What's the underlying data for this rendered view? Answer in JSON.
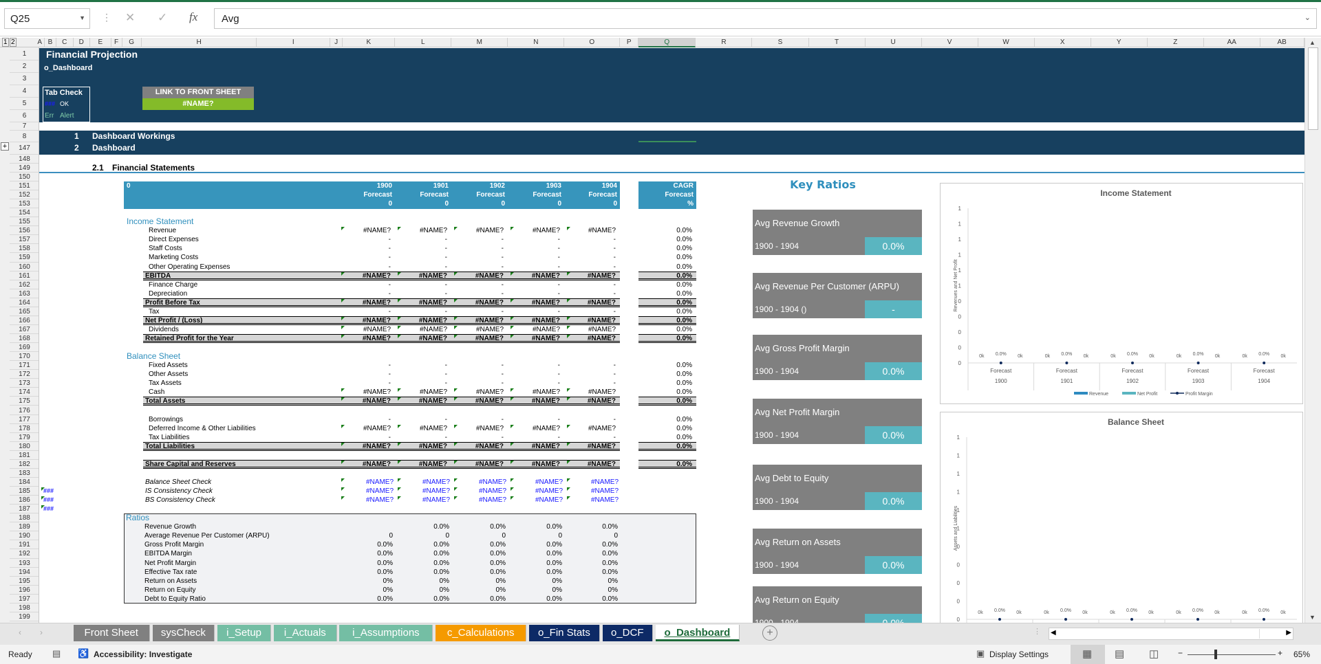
{
  "formula_bar": {
    "name_box": "Q25",
    "formula": "Avg",
    "cancel_icon": "✕",
    "enter_icon": "✓",
    "fx_icon": "fx"
  },
  "outline_levels": [
    "1",
    "2"
  ],
  "columns": [
    "A",
    "B",
    "C",
    "D",
    "E",
    "F",
    "G",
    "H",
    "I",
    "J",
    "K",
    "L",
    "M",
    "N",
    "O",
    "P",
    "Q",
    "R",
    "S",
    "T",
    "U",
    "V",
    "W",
    "X",
    "Y",
    "Z",
    "AA",
    "AB"
  ],
  "selected_column": "Q",
  "rows": [
    1,
    2,
    3,
    4,
    5,
    6,
    7,
    8,
    147,
    148,
    149,
    150,
    151,
    152,
    153,
    154,
    155,
    156,
    157,
    158,
    159,
    160,
    161,
    162,
    163,
    164,
    165,
    166,
    167,
    168,
    169,
    170,
    171,
    172,
    173,
    174,
    175,
    176,
    177,
    178,
    179,
    180,
    181,
    182,
    183,
    184,
    185,
    186,
    187,
    188,
    189,
    190,
    191,
    192,
    193,
    194,
    195,
    196,
    197,
    198,
    199
  ],
  "header": {
    "title": "Financial Projection",
    "sheet": "o_Dashboard",
    "tab_check": {
      "label": "Tab Check",
      "count": "###",
      "status": "OK",
      "err": "Err",
      "alert": "Alert"
    },
    "link_label": "LINK TO FRONT SHEET",
    "link_value": "#NAME?"
  },
  "sections": [
    {
      "num": "1",
      "label": "Dashboard Workings"
    },
    {
      "num": "2",
      "label": "Dashboard"
    }
  ],
  "subsection": {
    "num": "2.1",
    "label": "Financial Statements"
  },
  "outline_markers": [
    "###",
    "###",
    "###"
  ],
  "table_header": {
    "corner": "0",
    "years": [
      "1900",
      "1901",
      "1902",
      "1903",
      "1904"
    ],
    "type": "Forecast",
    "sub": [
      "0",
      "0",
      "0",
      "0",
      "0"
    ],
    "cagr": {
      "label": "CAGR",
      "type": "Forecast",
      "unit": "%"
    }
  },
  "statements": [
    {
      "row": 155,
      "section": "Income Statement"
    },
    {
      "row": 156,
      "label": "Revenue",
      "values": [
        "#NAME?",
        "#NAME?",
        "#NAME?",
        "#NAME?",
        "#NAME?"
      ],
      "cagr": "0.0%"
    },
    {
      "row": 157,
      "label": "Direct Expenses",
      "values": [
        "-",
        "-",
        "-",
        "-",
        "-"
      ],
      "cagr": "0.0%"
    },
    {
      "row": 158,
      "label": "Staff Costs",
      "values": [
        "-",
        "-",
        "-",
        "-",
        "-"
      ],
      "cagr": "0.0%"
    },
    {
      "row": 159,
      "label": "Marketing Costs",
      "values": [
        "-",
        "-",
        "-",
        "-",
        "-"
      ],
      "cagr": "0.0%"
    },
    {
      "row": 160,
      "label": "Other Operating Expenses",
      "values": [
        "-",
        "-",
        "-",
        "-",
        "-"
      ],
      "cagr": "0.0%"
    },
    {
      "row": 161,
      "label": "EBITDA",
      "values": [
        "#NAME?",
        "#NAME?",
        "#NAME?",
        "#NAME?",
        "#NAME?"
      ],
      "cagr": "0.0%",
      "total": true
    },
    {
      "row": 162,
      "label": "Finance Charge",
      "values": [
        "-",
        "-",
        "-",
        "-",
        "-"
      ],
      "cagr": "0.0%"
    },
    {
      "row": 163,
      "label": "Depreciation",
      "values": [
        "-",
        "-",
        "-",
        "-",
        "-"
      ],
      "cagr": "0.0%"
    },
    {
      "row": 164,
      "label": "Profit Before Tax",
      "values": [
        "#NAME?",
        "#NAME?",
        "#NAME?",
        "#NAME?",
        "#NAME?"
      ],
      "cagr": "0.0%",
      "total": true
    },
    {
      "row": 165,
      "label": "Tax",
      "values": [
        "-",
        "-",
        "-",
        "-",
        "-"
      ],
      "cagr": "0.0%"
    },
    {
      "row": 166,
      "label": "Net Profit / (Loss)",
      "values": [
        "#NAME?",
        "#NAME?",
        "#NAME?",
        "#NAME?",
        "#NAME?"
      ],
      "cagr": "0.0%",
      "total": true
    },
    {
      "row": 167,
      "label": "Dividends",
      "values": [
        "#NAME?",
        "#NAME?",
        "#NAME?",
        "#NAME?",
        "#NAME?"
      ],
      "cagr": "0.0%"
    },
    {
      "row": 168,
      "label": "Retained Profit for the Year",
      "values": [
        "#NAME?",
        "#NAME?",
        "#NAME?",
        "#NAME?",
        "#NAME?"
      ],
      "cagr": "0.0%",
      "total": true
    },
    {
      "row": 170,
      "section": "Balance Sheet"
    },
    {
      "row": 171,
      "label": "Fixed Assets",
      "values": [
        "-",
        "-",
        "-",
        "-",
        "-"
      ],
      "cagr": "0.0%"
    },
    {
      "row": 172,
      "label": "Other Assets",
      "values": [
        "-",
        "-",
        "-",
        "-",
        "-"
      ],
      "cagr": "0.0%"
    },
    {
      "row": 173,
      "label": "Tax Assets",
      "values": [
        "-",
        "-",
        "-",
        "-",
        "-"
      ],
      "cagr": "0.0%"
    },
    {
      "row": 174,
      "label": "Cash",
      "values": [
        "#NAME?",
        "#NAME?",
        "#NAME?",
        "#NAME?",
        "#NAME?"
      ],
      "cagr": "0.0%"
    },
    {
      "row": 175,
      "label": "Total Assets",
      "values": [
        "#NAME?",
        "#NAME?",
        "#NAME?",
        "#NAME?",
        "#NAME?"
      ],
      "cagr": "0.0%",
      "total": true
    },
    {
      "row": 177,
      "label": "Borrowings",
      "values": [
        "-",
        "-",
        "-",
        "-",
        "-"
      ],
      "cagr": "0.0%"
    },
    {
      "row": 178,
      "label": "Deferred Income & Other Liabilities",
      "values": [
        "#NAME?",
        "#NAME?",
        "#NAME?",
        "#NAME?",
        "#NAME?"
      ],
      "cagr": "0.0%"
    },
    {
      "row": 179,
      "label": "Tax Liabilities",
      "values": [
        "-",
        "-",
        "-",
        "-",
        "-"
      ],
      "cagr": "0.0%"
    },
    {
      "row": 180,
      "label": "Total Liabilities",
      "values": [
        "#NAME?",
        "#NAME?",
        "#NAME?",
        "#NAME?",
        "#NAME?"
      ],
      "cagr": "0.0%",
      "total": true
    },
    {
      "row": 182,
      "label": "Share Capital and Reserves",
      "values": [
        "#NAME?",
        "#NAME?",
        "#NAME?",
        "#NAME?",
        "#NAME?"
      ],
      "cagr": "0.0%",
      "total": true
    },
    {
      "row": 184,
      "label": "Balance Sheet Check",
      "values": [
        "#NAME?",
        "#NAME?",
        "#NAME?",
        "#NAME?",
        "#NAME?"
      ],
      "check": true
    },
    {
      "row": 185,
      "label": "IS Consistency Check",
      "values": [
        "#NAME?",
        "#NAME?",
        "#NAME?",
        "#NAME?",
        "#NAME?"
      ],
      "check": true
    },
    {
      "row": 186,
      "label": "BS Consistency Check",
      "values": [
        "#NAME?",
        "#NAME?",
        "#NAME?",
        "#NAME?",
        "#NAME?"
      ],
      "check": true
    }
  ],
  "ratios": {
    "title": "Ratios",
    "rows": [
      {
        "label": "Revenue Growth",
        "values": [
          "",
          "0.0%",
          "0.0%",
          "0.0%",
          "0.0%"
        ]
      },
      {
        "label": "Average Revenue Per Customer (ARPU)",
        "values": [
          "0",
          "0",
          "0",
          "0",
          "0"
        ]
      },
      {
        "label": "Gross Profit Margin",
        "values": [
          "0.0%",
          "0.0%",
          "0.0%",
          "0.0%",
          "0.0%"
        ]
      },
      {
        "label": "EBITDA Margin",
        "values": [
          "0.0%",
          "0.0%",
          "0.0%",
          "0.0%",
          "0.0%"
        ]
      },
      {
        "label": "Net Profit Margin",
        "values": [
          "0.0%",
          "0.0%",
          "0.0%",
          "0.0%",
          "0.0%"
        ]
      },
      {
        "label": "Effective Tax rate",
        "values": [
          "0.0%",
          "0.0%",
          "0.0%",
          "0.0%",
          "0.0%"
        ]
      },
      {
        "label": "Return on Assets",
        "values": [
          "0%",
          "0%",
          "0%",
          "0%",
          "0%"
        ]
      },
      {
        "label": "Return on Equity",
        "values": [
          "0%",
          "0%",
          "0%",
          "0%",
          "0%"
        ]
      },
      {
        "label": "Debt to Equity Ratio",
        "values": [
          "0.0%",
          "0.0%",
          "0.0%",
          "0.0%",
          "0.0%"
        ]
      }
    ]
  },
  "key_ratios": {
    "title": "Key Ratios",
    "cards": [
      {
        "title": "Avg Revenue Growth",
        "period": "1900 - 1904",
        "value": "0.0%"
      },
      {
        "title": "Avg Revenue Per Customer (ARPU)",
        "period": "1900 - 1904 ()",
        "value": "-"
      },
      {
        "title": "Avg Gross Profit Margin",
        "period": "1900 - 1904",
        "value": "0.0%"
      },
      {
        "title": "Avg Net Profit Margin",
        "period": "1900 - 1904",
        "value": "0.0%"
      },
      {
        "title": "Avg Debt to Equity",
        "period": "1900 - 1904",
        "value": "0.0%"
      },
      {
        "title": "Avg Return on Assets",
        "period": "1900 - 1904",
        "value": "0.0%"
      },
      {
        "title": "Avg Return on Equity",
        "period": "1900 - 1904",
        "value": "0.0%"
      }
    ]
  },
  "chart_data": [
    {
      "type": "bar",
      "title": "Income Statement",
      "ylabel": "Revenues and Net Profit",
      "y_tick_labels": [
        "1",
        "1",
        "1",
        "1",
        "1",
        "1",
        "0",
        "0",
        "0",
        "0",
        "0"
      ],
      "categories": [
        [
          "Forecast",
          "1900"
        ],
        [
          "Forecast",
          "1901"
        ],
        [
          "Forecast",
          "1902"
        ],
        [
          "Forecast",
          "1903"
        ],
        [
          "Forecast",
          "1904"
        ]
      ],
      "series": [
        {
          "name": "Revenue",
          "kind": "bar",
          "values": [
            0,
            0,
            0,
            0,
            0
          ],
          "labels": [
            "0k",
            "0k",
            "0k",
            "0k",
            "0k"
          ],
          "color": "#2e8bc0"
        },
        {
          "name": "Net Profit",
          "kind": "bar",
          "values": [
            0,
            0,
            0,
            0,
            0
          ],
          "labels": [
            "0k",
            "0k",
            "0k",
            "0k",
            "0k"
          ],
          "color": "#5ab5c0"
        },
        {
          "name": "Profit Margin",
          "kind": "line",
          "values": [
            0,
            0,
            0,
            0,
            0
          ],
          "labels": [
            "0.0%",
            "0.0%",
            "0.0%",
            "0.0%",
            "0.0%"
          ],
          "color": "#0f2a5c"
        }
      ],
      "legend": "bottom",
      "grid": false
    },
    {
      "type": "bar",
      "title": "Balance Sheet",
      "ylabel": "Assets and Liabilities",
      "y_tick_labels": [
        "1",
        "1",
        "1",
        "1",
        "1",
        "1",
        "0",
        "0",
        "0",
        "0",
        "0"
      ],
      "categories": [
        [
          "",
          ""
        ],
        [
          "",
          ""
        ],
        [
          "",
          ""
        ],
        [
          "",
          ""
        ],
        [
          "",
          ""
        ]
      ],
      "series": [
        {
          "kind": "bar",
          "values": [
            0,
            0,
            0,
            0,
            0
          ],
          "labels": [
            "0k",
            "0k",
            "0k",
            "0k",
            "0k"
          ],
          "color": "#2e8bc0"
        },
        {
          "kind": "bar",
          "values": [
            0,
            0,
            0,
            0,
            0
          ],
          "labels": [
            "0k",
            "0k",
            "0k",
            "0k",
            "0k"
          ],
          "color": "#5ab5c0"
        },
        {
          "kind": "line",
          "values": [
            0,
            0,
            0,
            0,
            0
          ],
          "labels": [
            "0.0%",
            "0.0%",
            "0.0%",
            "0.0%",
            "0.0%"
          ],
          "color": "#0f2a5c"
        }
      ],
      "legend": "none",
      "grid": false
    }
  ],
  "sheet_tabs": [
    {
      "label": "Front Sheet",
      "color": "#808080"
    },
    {
      "label": "sysCheck",
      "color": "#808080"
    },
    {
      "label": "i_Setup",
      "color": "#74bea4"
    },
    {
      "label": "i_Actuals",
      "color": "#74bea4"
    },
    {
      "label": "i_Assumptions",
      "color": "#74bea4"
    },
    {
      "label": "c_Calculations",
      "color": "#f59a00"
    },
    {
      "label": "o_Fin Stats",
      "color": "#0d2a66"
    },
    {
      "label": "o_DCF",
      "color": "#0d2a66"
    },
    {
      "label": "o_Dashboard",
      "color": "#ffffff",
      "active": true
    }
  ],
  "status_bar": {
    "ready": "Ready",
    "accessibility": "Accessibility: Investigate",
    "display_settings": "Display Settings",
    "zoom": "65%"
  },
  "colors": {
    "band": "#17405f",
    "table_header": "#3795bc",
    "card": "#808080",
    "card_value": "#5ab5c0",
    "link_value": "#84bb29"
  }
}
